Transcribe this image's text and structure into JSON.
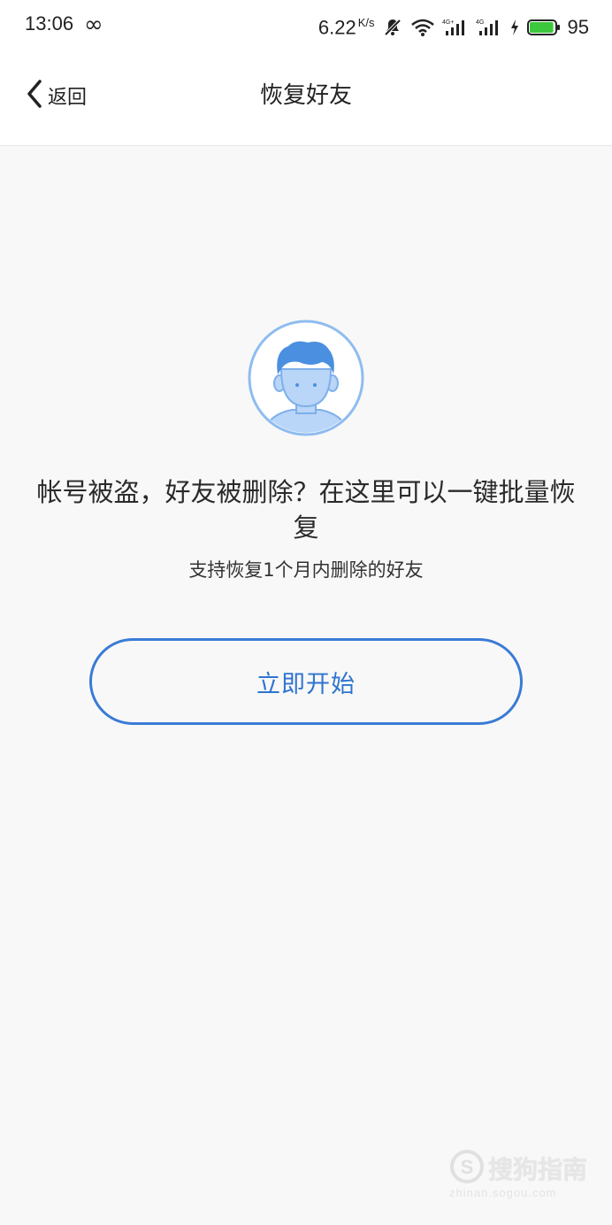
{
  "status_bar": {
    "time": "13:06",
    "infinity_glyph": "∞",
    "net_speed": "6.22",
    "net_speed_unit": "K/s",
    "battery_level": "95",
    "battery_fill_fraction": 0.95,
    "icons": [
      "infinity-icon",
      "mute-icon",
      "wifi-icon",
      "signal-4g-plus-icon",
      "signal-4g-icon",
      "charging-icon",
      "battery-icon"
    ]
  },
  "nav": {
    "back_label": "返回",
    "title": "恢复好友"
  },
  "main": {
    "avatar_icon": "user-avatar-icon",
    "headline": "帐号被盗，好友被删除？在这里可以一键批量恢复",
    "subline": "支持恢复1个月内删除的好友",
    "start_button_label": "立即开始"
  },
  "watermark": {
    "text": "搜狗指南",
    "url": "zhinan.sogou.com"
  },
  "colors": {
    "accent": "#3a7bd5",
    "background": "#f8f8f8",
    "battery": "#3cc83c"
  }
}
